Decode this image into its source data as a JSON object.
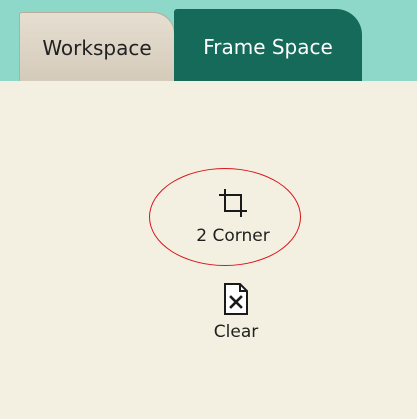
{
  "tabs": [
    {
      "label": "Workspace",
      "active": false
    },
    {
      "label": "Frame Space",
      "active": true
    }
  ],
  "tools": {
    "two_corner": {
      "label": "2 Corner",
      "icon": "crop-icon"
    },
    "clear": {
      "label": "Clear",
      "icon": "clear-document-icon"
    }
  },
  "colors": {
    "tab_active_bg": "#166a59",
    "tab_bar_bg": "#8ed8c9",
    "panel_bg": "#f4f0e1",
    "highlight": "#d8151b"
  }
}
